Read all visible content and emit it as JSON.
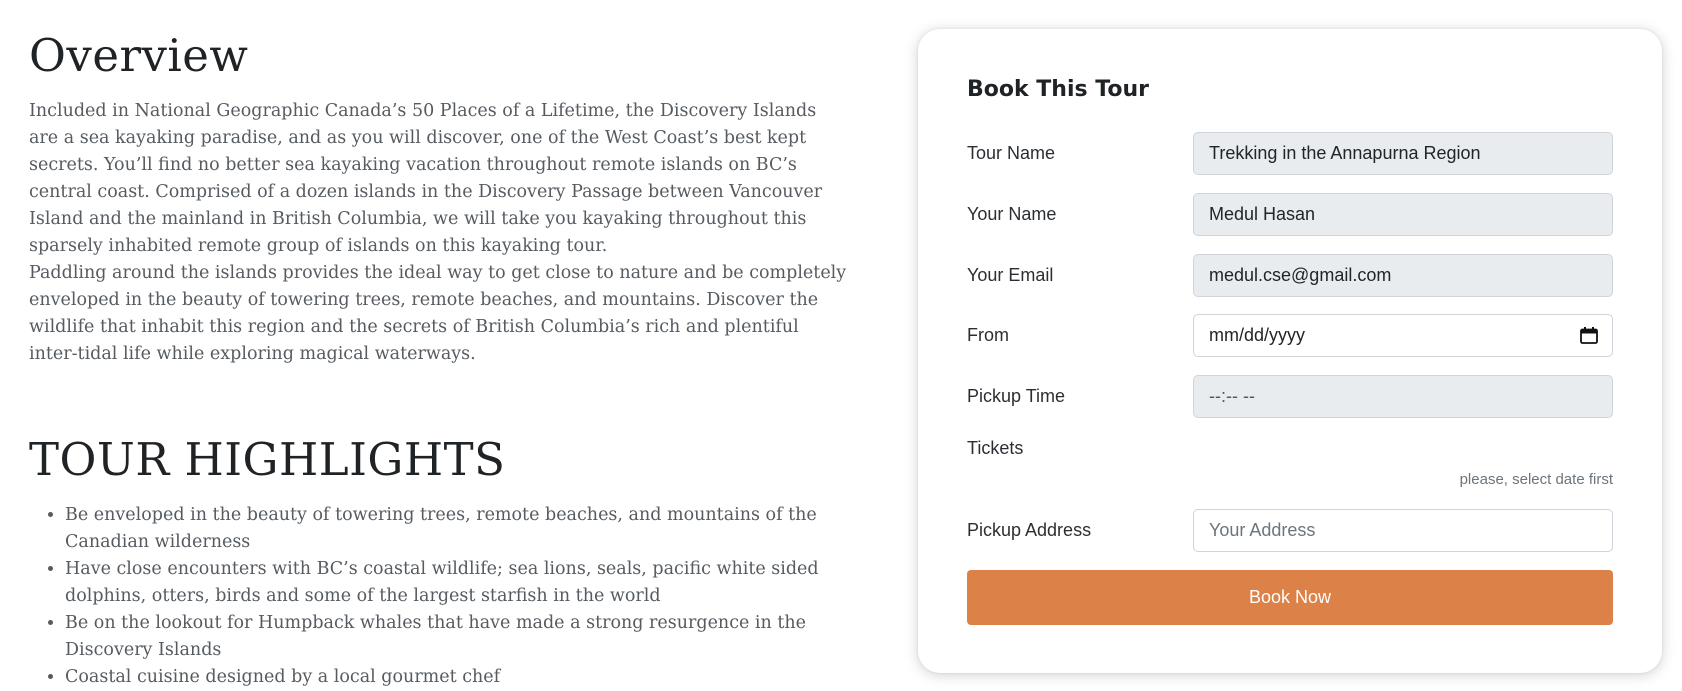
{
  "overview": {
    "title": "Overview",
    "paragraphs": [
      "Included in National Geographic Canada’s 50 Places of a Lifetime, the Discovery Islands are a sea kayaking paradise, and as you will discover, one of the West Coast’s best kept secrets. You’ll find no better sea kayaking vacation throughout remote islands on BC’s central coast. Comprised of a dozen islands in the Discovery Passage between Vancouver Island and the mainland in British Columbia, we will take you kayaking throughout this sparsely inhabited remote group of islands on this kayaking tour.",
      "Paddling around the islands provides the ideal way to get close to nature and be completely enveloped in the beauty of towering trees, remote beaches, and mountains. Discover the wildlife that inhabit this region and the secrets of British Columbia’s rich and plentiful inter-tidal life while exploring magical waterways."
    ]
  },
  "highlights": {
    "title": "TOUR HIGHLIGHTS",
    "items": [
      "Be enveloped in the beauty of towering trees, remote beaches, and mountains of the Canadian wilderness",
      "Have close encounters with BC’s coastal wildlife; sea lions, seals, pacific white sided dolphins, otters, birds and some of the largest starfish in the world",
      "Be on the lookout for Humpback whales that have made a strong resurgence in the Discovery Islands",
      "Coastal cuisine designed by a local gourmet chef"
    ]
  },
  "booking": {
    "title": "Book This Tour",
    "tour_name": {
      "label": "Tour Name",
      "value": "Trekking in the Annapurna Region"
    },
    "your_name": {
      "label": "Your Name",
      "value": "Medul Hasan"
    },
    "your_email": {
      "label": "Your Email",
      "value": "medul.cse@gmail.com"
    },
    "from": {
      "label": "From",
      "placeholder": "mm/dd/yyyy",
      "icon": "calendar-icon"
    },
    "pickup_time": {
      "label": "Pickup Time",
      "placeholder": "--:-- --"
    },
    "tickets": {
      "label": "Tickets",
      "hint": "please, select date first"
    },
    "pickup_address": {
      "label": "Pickup Address",
      "placeholder": "Your Address"
    },
    "button_label": "Book Now",
    "accent_color": "#dc8148"
  }
}
